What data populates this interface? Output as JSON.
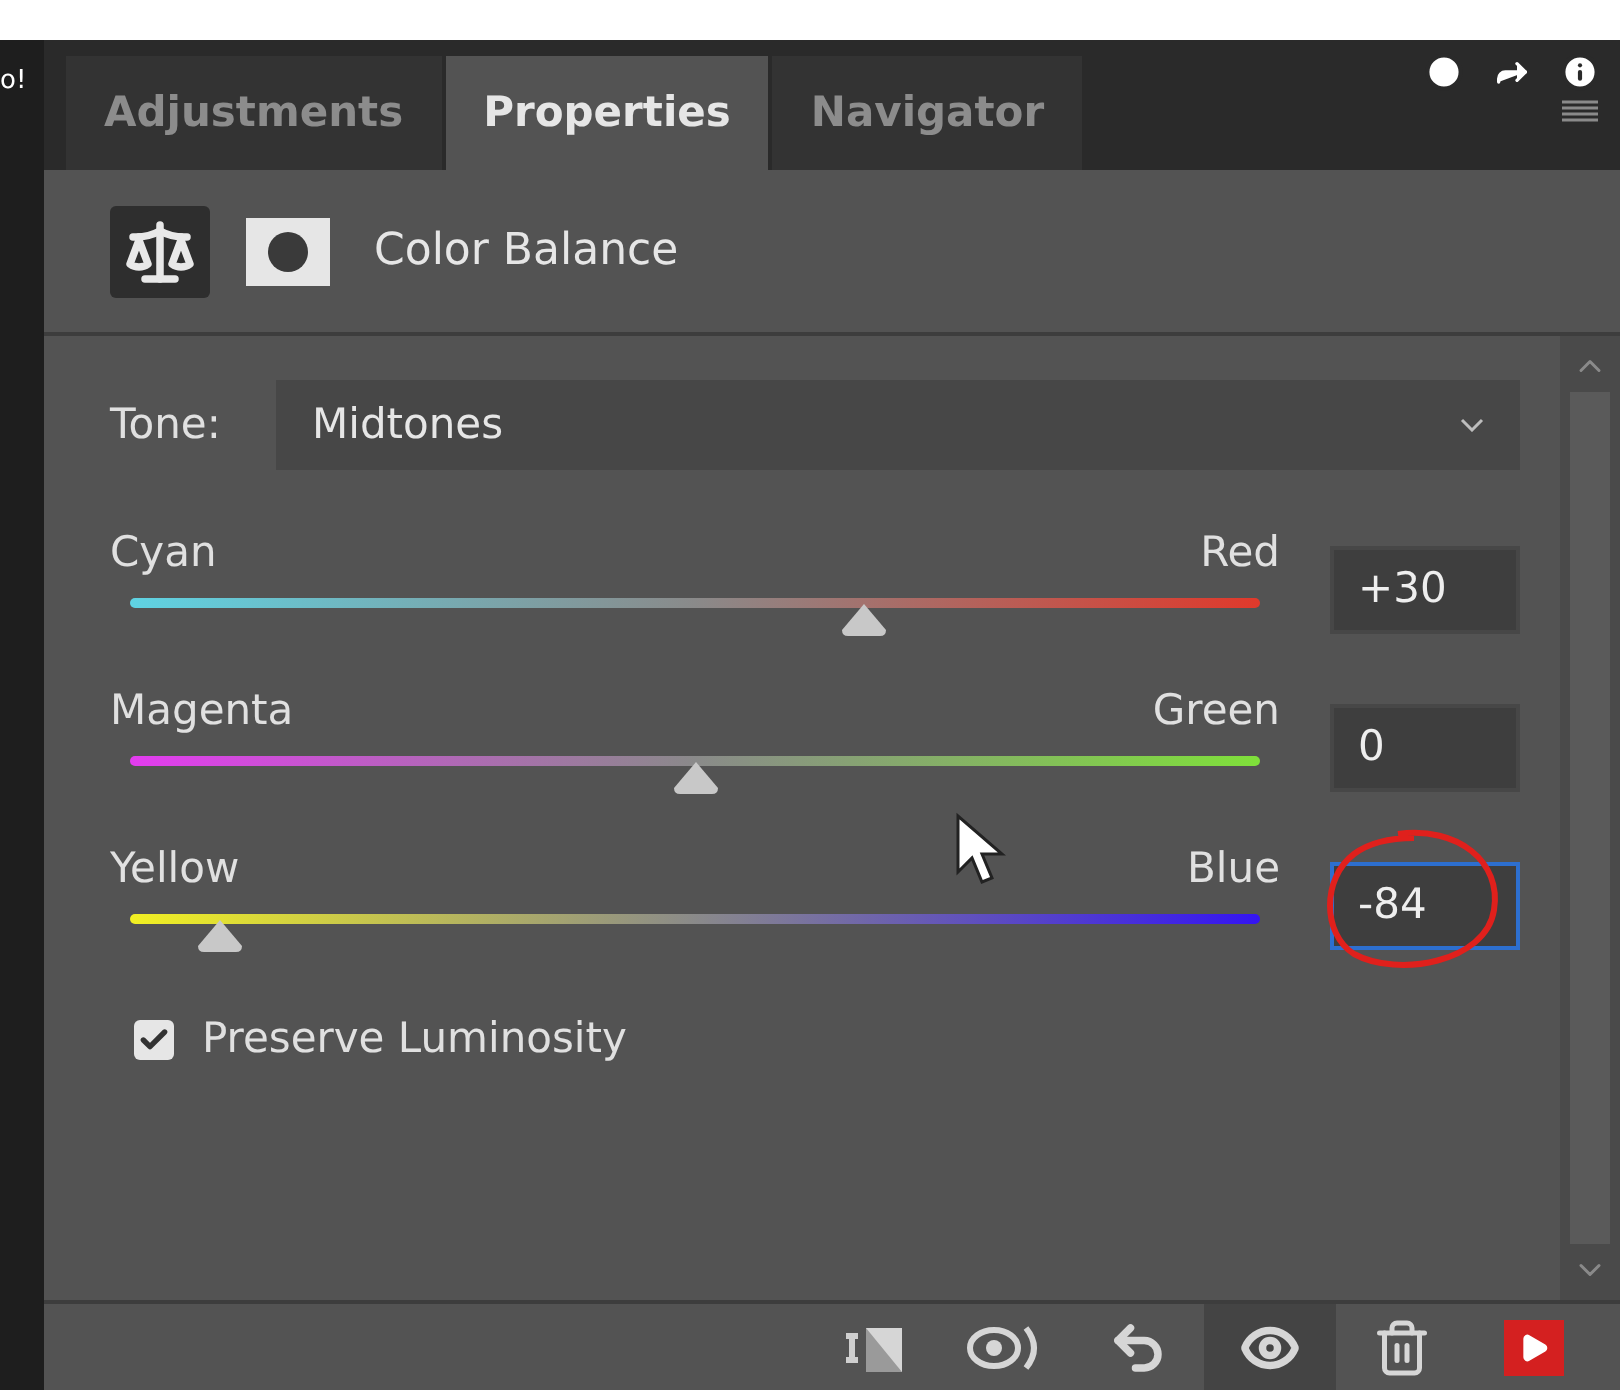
{
  "left_edge_text": "o!",
  "tabs": [
    {
      "label": "Adjustments",
      "selected": false
    },
    {
      "label": "Properties",
      "selected": true
    },
    {
      "label": "Navigator",
      "selected": false
    }
  ],
  "header": {
    "title": "Color Balance"
  },
  "tone": {
    "label": "Tone:",
    "value": "Midtones"
  },
  "sliders": [
    {
      "left": "Cyan",
      "right": "Red",
      "value": "+30",
      "level": 0.65,
      "kind": "cyan-red",
      "circled": false,
      "focused": false
    },
    {
      "left": "Magenta",
      "right": "Green",
      "value": "0",
      "level": 0.5,
      "kind": "magenta-green",
      "circled": false,
      "focused": false
    },
    {
      "left": "Yellow",
      "right": "Blue",
      "value": "-84",
      "level": 0.08,
      "kind": "yellow-blue",
      "circled": true,
      "focused": true
    }
  ],
  "preserve_luminosity": {
    "label": "Preserve Luminosity",
    "checked": true
  },
  "toolbar": [
    {
      "kind": "clip",
      "selected": false
    },
    {
      "kind": "view-previous",
      "selected": false
    },
    {
      "kind": "reset",
      "selected": false
    },
    {
      "kind": "visibility",
      "selected": true
    },
    {
      "kind": "delete",
      "selected": false
    },
    {
      "kind": "play",
      "selected": false
    }
  ]
}
